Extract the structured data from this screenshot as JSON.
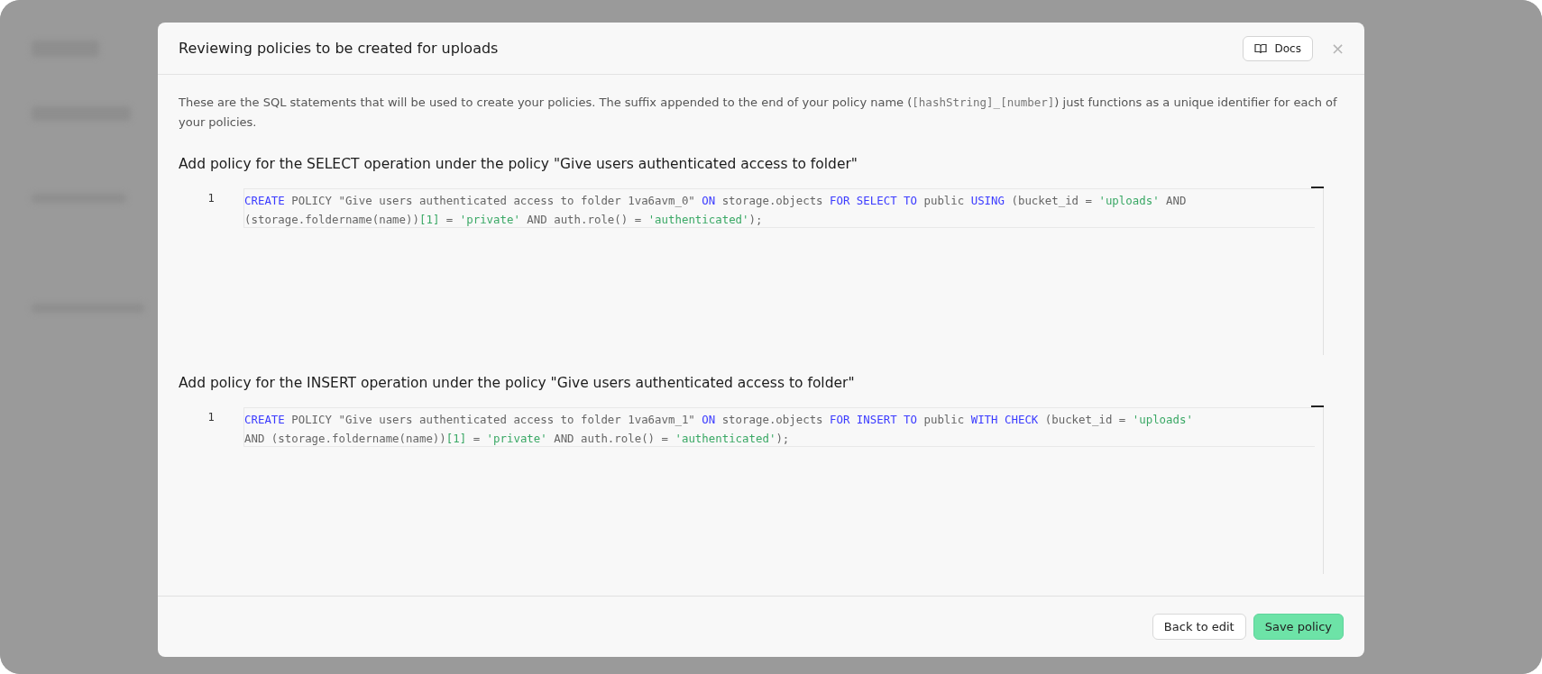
{
  "modal": {
    "title": "Reviewing policies to be created for uploads",
    "docs_button": "Docs",
    "close": "×"
  },
  "intro": {
    "before": "These are the SQL statements that will be used to create your policies. The suffix appended to the end of your policy name (",
    "code": "[hashString]_[number]",
    "after": ") just functions as a unique identifier for each of your policies."
  },
  "policies": [
    {
      "heading": "Add policy for the SELECT operation under the policy \"Give users authenticated access to folder\"",
      "line_number": "1",
      "lines": [
        [
          {
            "kind": "keyword",
            "text": "CREATE"
          },
          {
            "kind": "plain",
            "text": " POLICY \"Give users authenticated access to folder 1va6avm_0\" "
          },
          {
            "kind": "keyword",
            "text": "ON"
          },
          {
            "kind": "plain",
            "text": " storage.objects "
          },
          {
            "kind": "keyword",
            "text": "FOR SELECT TO"
          },
          {
            "kind": "plain",
            "text": " public "
          },
          {
            "kind": "keyword",
            "text": "USING"
          },
          {
            "kind": "plain",
            "text": " (bucket_id = "
          },
          {
            "kind": "string",
            "text": "'uploads'"
          },
          {
            "kind": "plain",
            "text": " AND"
          }
        ],
        [
          {
            "kind": "plain",
            "text": "(storage.foldername(name))"
          },
          {
            "kind": "string",
            "text": "[1]"
          },
          {
            "kind": "plain",
            "text": " = "
          },
          {
            "kind": "string",
            "text": "'private'"
          },
          {
            "kind": "plain",
            "text": " AND auth.role() = "
          },
          {
            "kind": "string",
            "text": "'authenticated'"
          },
          {
            "kind": "plain",
            "text": ");"
          }
        ]
      ]
    },
    {
      "heading": "Add policy for the INSERT operation under the policy \"Give users authenticated access to folder\"",
      "line_number": "1",
      "lines": [
        [
          {
            "kind": "keyword",
            "text": "CREATE"
          },
          {
            "kind": "plain",
            "text": " POLICY \"Give users authenticated access to folder 1va6avm_1\" "
          },
          {
            "kind": "keyword",
            "text": "ON"
          },
          {
            "kind": "plain",
            "text": " storage.objects "
          },
          {
            "kind": "keyword",
            "text": "FOR INSERT TO"
          },
          {
            "kind": "plain",
            "text": " public "
          },
          {
            "kind": "keyword",
            "text": "WITH CHECK"
          },
          {
            "kind": "plain",
            "text": " (bucket_id = "
          },
          {
            "kind": "string",
            "text": "'uploads'"
          }
        ],
        [
          {
            "kind": "plain",
            "text": "AND (storage.foldername(name))"
          },
          {
            "kind": "string",
            "text": "[1]"
          },
          {
            "kind": "plain",
            "text": " = "
          },
          {
            "kind": "string",
            "text": "'private'"
          },
          {
            "kind": "plain",
            "text": " AND auth.role() = "
          },
          {
            "kind": "string",
            "text": "'authenticated'"
          },
          {
            "kind": "plain",
            "text": ");"
          }
        ]
      ]
    }
  ],
  "footer": {
    "buttons": [
      {
        "kind": "secondary",
        "label": "Back to edit"
      },
      {
        "kind": "primary",
        "label": "Save policy"
      }
    ]
  }
}
